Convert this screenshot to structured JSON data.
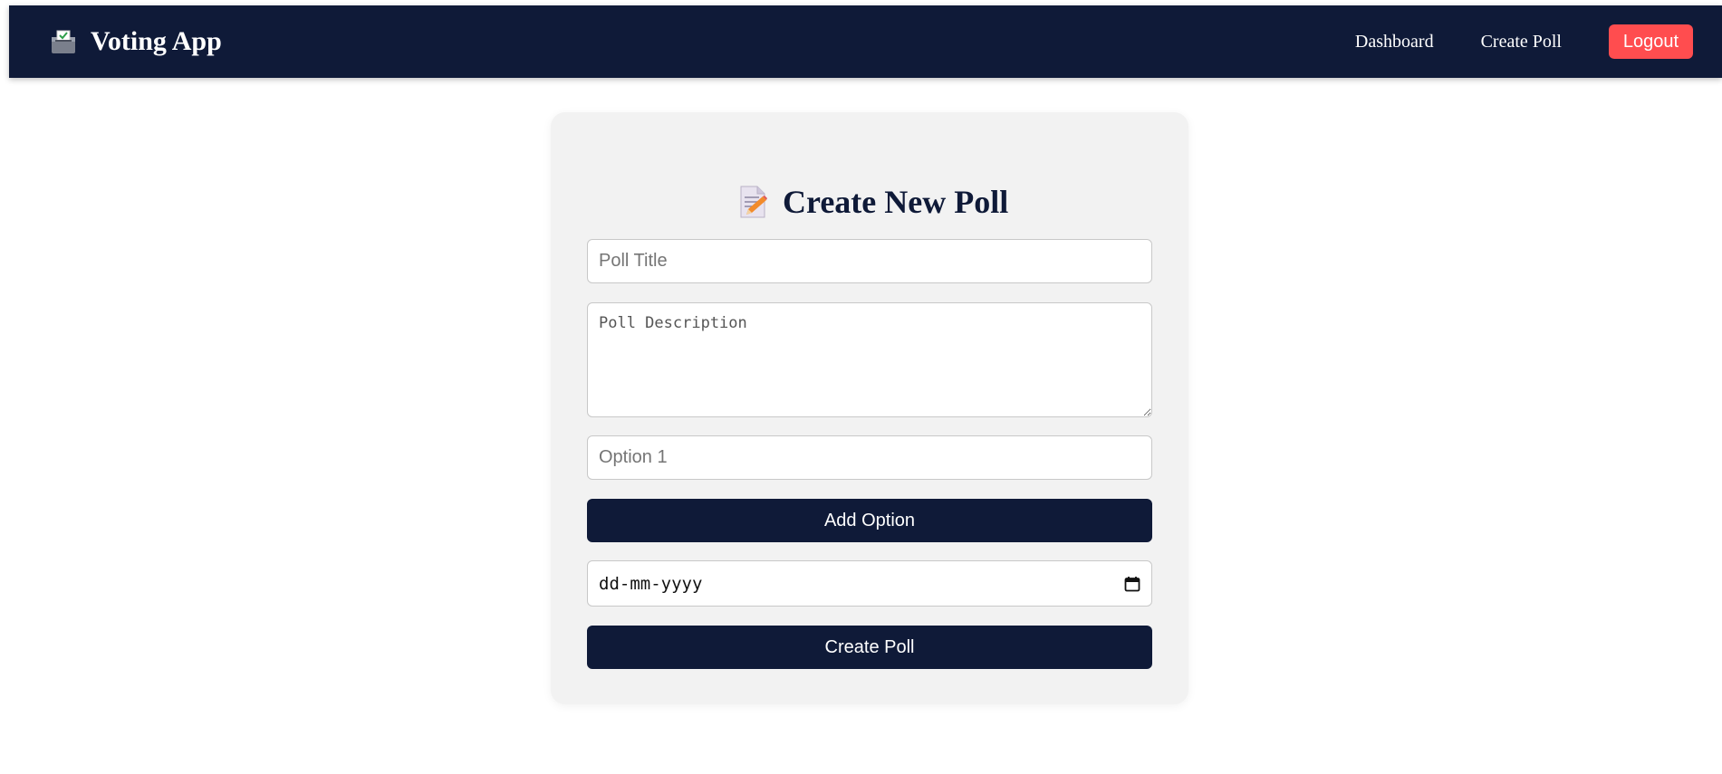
{
  "navbar": {
    "brand_icon": "ballot-box-icon",
    "brand_title": "Voting App",
    "links": [
      {
        "label": "Dashboard"
      },
      {
        "label": "Create Poll"
      }
    ],
    "logout_label": "Logout",
    "background_color": "#0f1a38",
    "logout_color": "#ff4d4f"
  },
  "form": {
    "heading_icon": "memo-pencil-icon",
    "heading": "Create New Poll",
    "title_placeholder": "Poll Title",
    "description_placeholder": "Poll Description",
    "option_placeholder": "Option 1",
    "add_option_label": "Add Option",
    "date_placeholder": "dd-mm-yyyy",
    "date_icon": "calendar-icon",
    "submit_label": "Create Poll",
    "card_background": "#f2f2f2",
    "button_color": "#0f1a38"
  }
}
